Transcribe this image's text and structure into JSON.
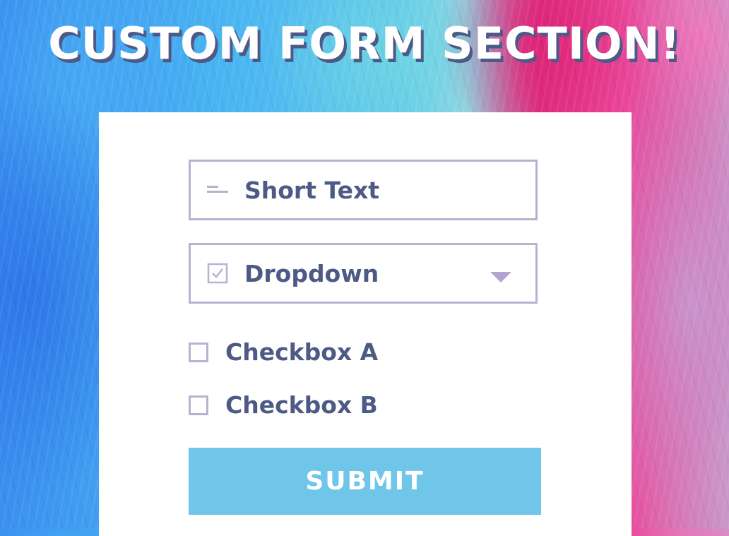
{
  "page": {
    "title": "CUSTOM FORM SECTION!"
  },
  "form": {
    "short_text": {
      "label": "Short Text",
      "icon": "short-text-icon"
    },
    "dropdown": {
      "label": "Dropdown",
      "icon": "checkbox-tick-icon",
      "toggle_icon": "chevron-down-icon"
    },
    "checkboxes": [
      {
        "label": "Checkbox A",
        "checked": false
      },
      {
        "label": "Checkbox B",
        "checked": false
      }
    ],
    "submit_label": "SUBMIT"
  },
  "colors": {
    "text": "#4d5a86",
    "border": "#b4b3d2",
    "submit_bg": "#6fc6e8",
    "chevron": "#b2a4cf",
    "title_shadow": "#4d5a86"
  }
}
